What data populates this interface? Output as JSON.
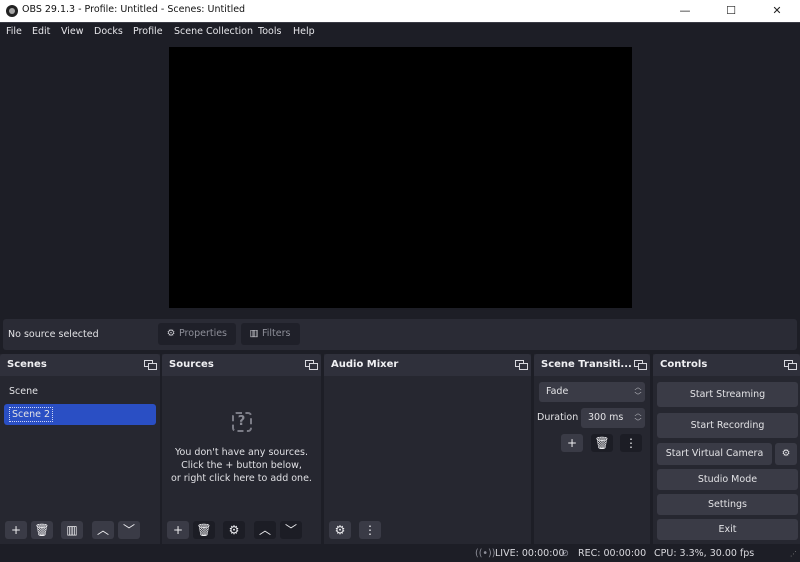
{
  "window": {
    "title": "OBS 29.1.3 - Profile: Untitled - Scenes: Untitled",
    "controls": {
      "minimize": "—",
      "maximize": "☐",
      "close": "✕"
    }
  },
  "menu": [
    "File",
    "Edit",
    "View",
    "Docks",
    "Profile",
    "Scene Collection",
    "Tools",
    "Help"
  ],
  "context_bar": {
    "status": "No source selected",
    "properties_label": "Properties",
    "filters_label": "Filters"
  },
  "docks": {
    "scenes": {
      "title": "Scenes",
      "items": [
        {
          "label": "Scene",
          "selected": false
        },
        {
          "label": "Scene 2",
          "selected": true
        }
      ],
      "toolbar": [
        "add-icon",
        "remove-icon",
        "filters-icon",
        "move-up-icon",
        "move-down-icon"
      ]
    },
    "sources": {
      "title": "Sources",
      "empty_lines": [
        "You don't have any sources.",
        "Click the + button below,",
        "or right click here to add one."
      ],
      "toolbar": [
        "add-icon",
        "remove-icon",
        "gear-icon",
        "move-up-icon",
        "move-down-icon"
      ]
    },
    "audio_mixer": {
      "title": "Audio Mixer",
      "toolbar": [
        "advanced-audio-icon",
        "more-icon"
      ]
    },
    "transitions": {
      "title": "Scene Transiti...",
      "selected_transition": "Fade",
      "duration_label": "Duration",
      "duration_value": "300 ms"
    },
    "controls": {
      "title": "Controls",
      "buttons": {
        "start_streaming": "Start Streaming",
        "start_recording": "Start Recording",
        "start_virtual_camera": "Start Virtual Camera",
        "studio_mode": "Studio Mode",
        "settings": "Settings",
        "exit": "Exit"
      }
    }
  },
  "status": {
    "live": "LIVE: 00:00:00",
    "rec": "REC: 00:00:00",
    "cpu": "CPU: 3.3%, 30.00 fps"
  },
  "colors": {
    "selection": "#2a4fc4",
    "background": "#1d1e26",
    "dock": "#262730",
    "button": "#3a3b46"
  }
}
